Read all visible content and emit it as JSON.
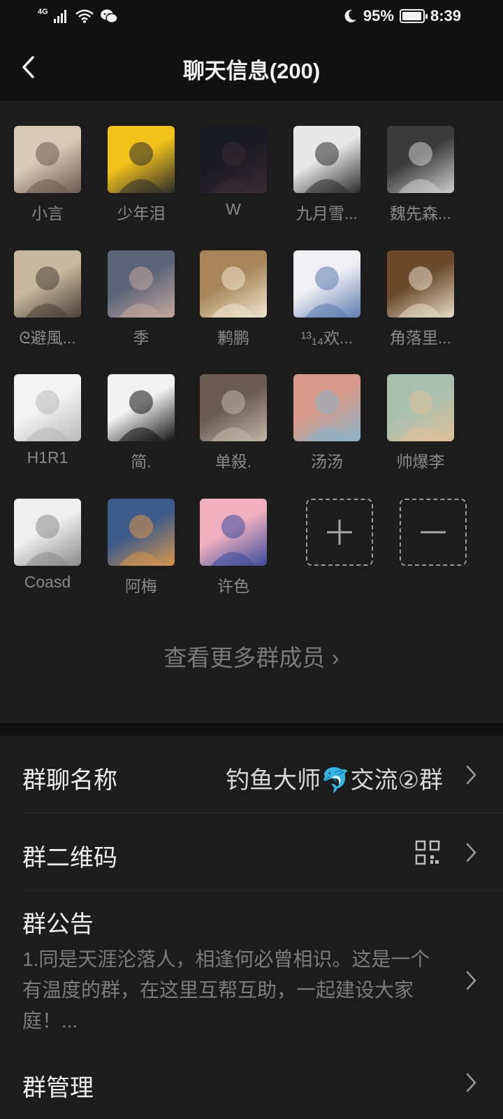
{
  "status_bar": {
    "network": "4G",
    "battery_percent": "95%",
    "battery_level": 0.95,
    "time": "8:39",
    "icons": [
      "signal-icon",
      "wifi-icon",
      "wechat-icon",
      "moon-icon",
      "battery-icon"
    ]
  },
  "header": {
    "title": "聊天信息(200)",
    "back_icon": "chevron-left-icon"
  },
  "members": [
    {
      "name": "小言"
    },
    {
      "name": "少年泪"
    },
    {
      "name": "W"
    },
    {
      "name": "九月雪..."
    },
    {
      "name": "魏先森..."
    },
    {
      "name": "ᘓ避風..."
    },
    {
      "name": "季"
    },
    {
      "name": "鹣鹏"
    },
    {
      "name": "¹³₁₄欢..."
    },
    {
      "name": "角落里..."
    },
    {
      "name": "H1R1"
    },
    {
      "name": "简."
    },
    {
      "name": "单殺."
    },
    {
      "name": "汤汤"
    },
    {
      "name": "帅爆李"
    },
    {
      "name": "Coasd"
    },
    {
      "name": "阿梅"
    },
    {
      "name": "许色"
    }
  ],
  "actions": {
    "add_icon": "plus-icon",
    "remove_icon": "minus-icon"
  },
  "see_more": "查看更多群成员 ›",
  "settings": {
    "group_name_label": "群聊名称",
    "group_name_value": "钓鱼大师🐬交流②群",
    "qr_label": "群二维码",
    "qr_icon": "qr-code-icon",
    "notice_label": "群公告",
    "notice_text": "1.同是天涯沦落人，相逢何必曾相识。这是一个有温度的群，在这里互帮互助，一起建设大家庭！...",
    "manage_label": "群管理"
  }
}
